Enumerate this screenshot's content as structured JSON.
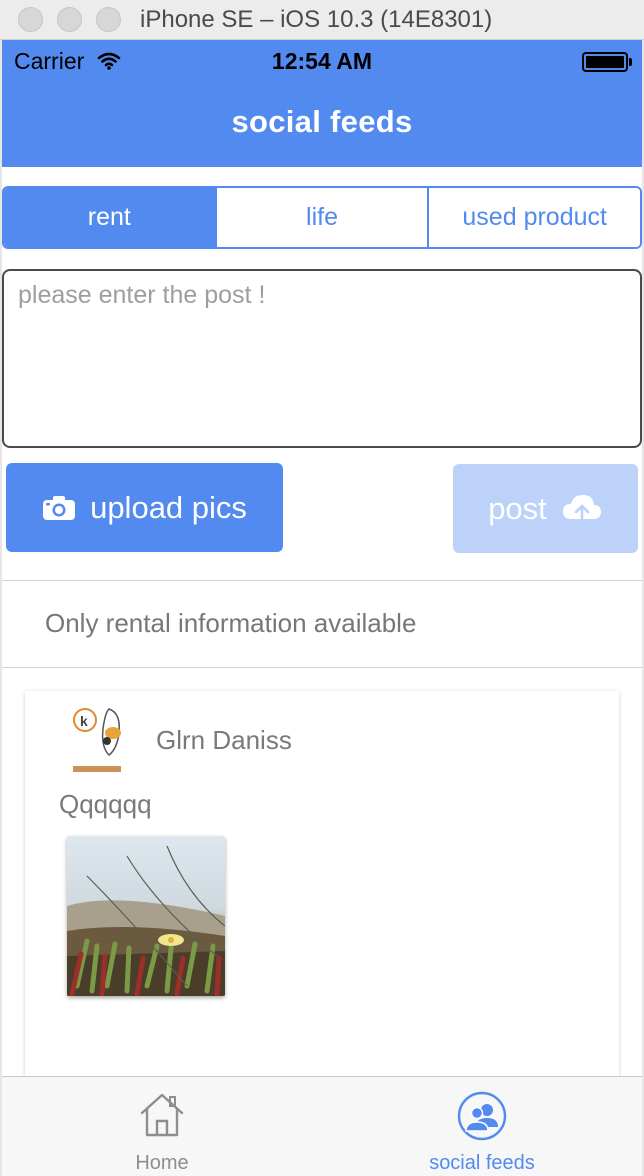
{
  "window": {
    "title": "iPhone SE – iOS 10.3 (14E8301)"
  },
  "status_bar": {
    "carrier": "Carrier",
    "time": "12:54 AM"
  },
  "nav": {
    "title": "social feeds"
  },
  "segments": [
    {
      "label": "rent",
      "active": true
    },
    {
      "label": "life",
      "active": false
    },
    {
      "label": "used product",
      "active": false
    }
  ],
  "post_input": {
    "placeholder": "please enter the post !",
    "value": ""
  },
  "buttons": {
    "upload_label": "upload pics",
    "post_label": "post"
  },
  "notice": "Only rental information available",
  "feed": [
    {
      "username": "Glrn Daniss",
      "text": "Qqqqqq",
      "image": "photo-thumbnail"
    }
  ],
  "tabbar": [
    {
      "label": "Home",
      "icon": "home-icon",
      "active": false
    },
    {
      "label": "social feeds",
      "icon": "people-icon",
      "active": true
    }
  ],
  "colors": {
    "accent": "#528af0",
    "accent_disabled": "#bcd2f9",
    "text_muted": "#7a7a7a",
    "window_chrome": "#ececec"
  }
}
